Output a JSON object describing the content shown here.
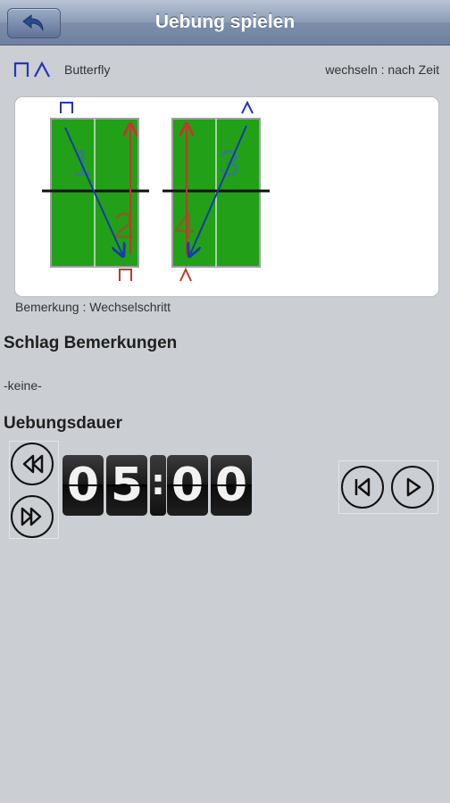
{
  "header": {
    "title": "Uebung spielen",
    "back_icon": "back-arrow-icon"
  },
  "exercise": {
    "mode_icon": "butterfly-icon",
    "mode_name": "Butterfly",
    "switch_label": "wechseln : nach Zeit",
    "diagram": {
      "table_color": "#1ea00e",
      "line_color_blue": "#1a3aa8",
      "line_color_red": "#c0392b",
      "labels": [
        "1",
        "2",
        "3",
        "4"
      ]
    },
    "remark": "Bemerkung : Wechselschritt"
  },
  "stroke_remarks": {
    "title": "Schlag Bemerkungen",
    "value": "-keine-"
  },
  "duration": {
    "title": "Uebungsdauer",
    "digits": [
      "0",
      "5",
      "0",
      "0"
    ],
    "separator": ":"
  },
  "controls": {
    "rewind_icon": "rewind-icon",
    "fast_forward_icon": "fast-forward-icon",
    "skip_back_icon": "skip-back-icon",
    "play_icon": "play-icon"
  }
}
